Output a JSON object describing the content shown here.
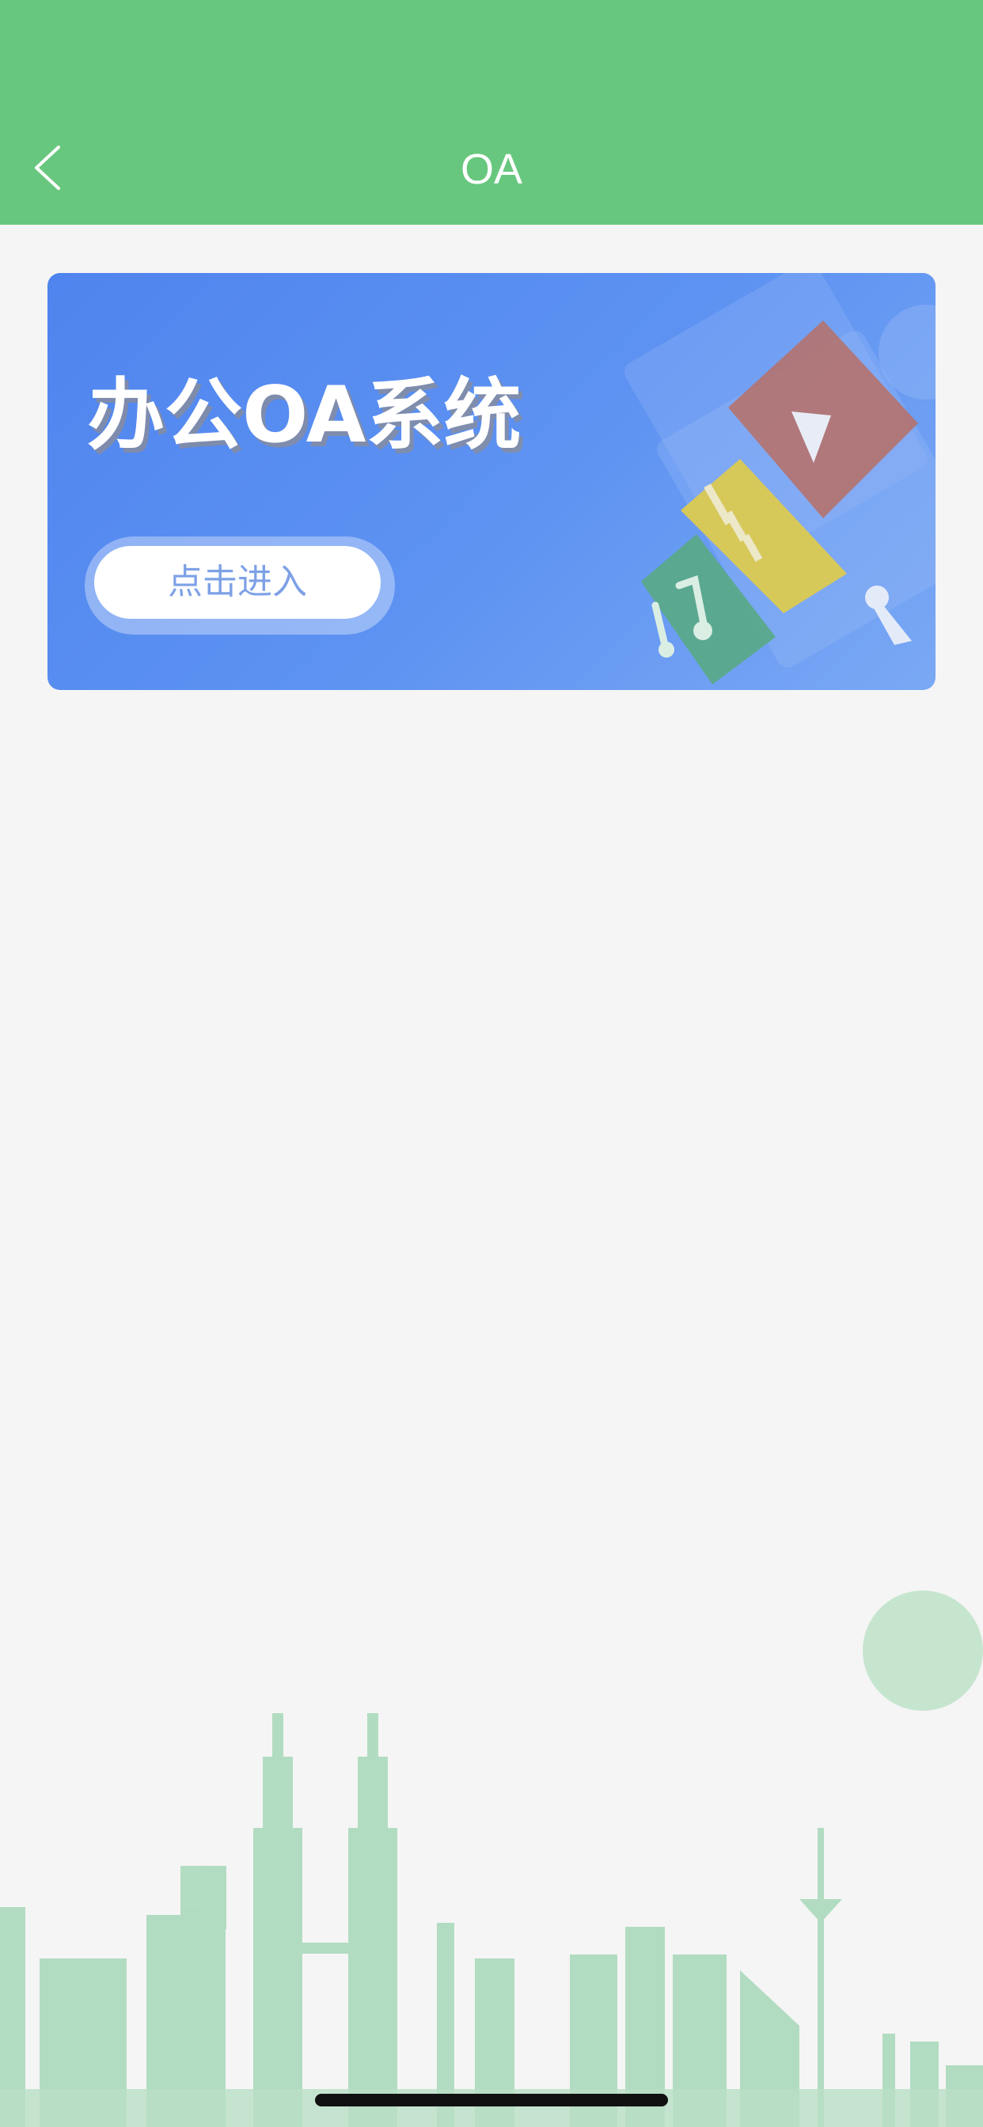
{
  "header": {
    "title": "OA",
    "back_icon": "chevron-left-icon",
    "color": "#68c77e"
  },
  "banner": {
    "title": "办公OA系统",
    "button_label": "点击进入",
    "background": "#5b8ff0",
    "button_text_color": "#7ea1e6",
    "illustration_icons": [
      "play-icon",
      "document-icon",
      "music-icon",
      "key-icon"
    ]
  },
  "background": {
    "decoration": "city-skyline",
    "skyline_color": "#a7d8b9"
  }
}
